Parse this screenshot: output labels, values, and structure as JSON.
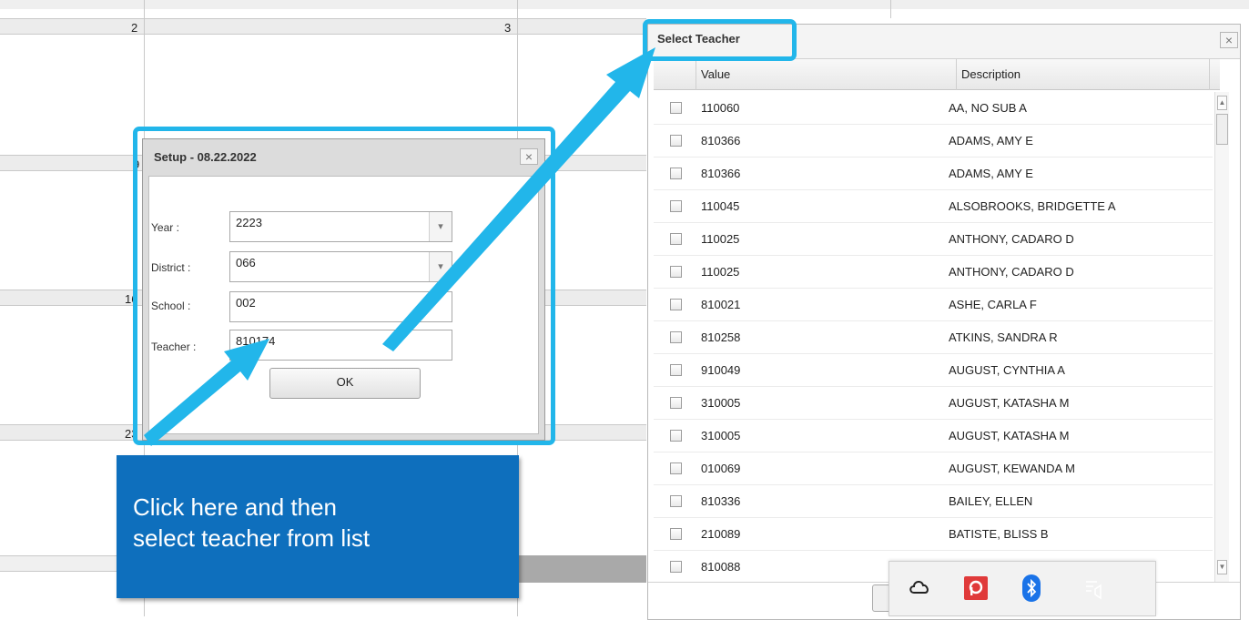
{
  "calendar": {
    "day_numbers": [
      "2",
      "3",
      "9",
      "16",
      "23"
    ]
  },
  "setup_dialog": {
    "title": "Setup - 08.22.2022",
    "close": "×",
    "year_label": "Year :",
    "year_value": "2223",
    "district_label": "District :",
    "district_value": "066",
    "school_label": "School :",
    "school_value": "002",
    "teacher_label": "Teacher :",
    "teacher_value": "810174",
    "ok_label": "OK"
  },
  "teacher_panel": {
    "title": "Select Teacher",
    "close": "×",
    "col_value": "Value",
    "col_description": "Description",
    "rows": [
      {
        "value": "110060",
        "description": "AA, NO SUB A"
      },
      {
        "value": "810366",
        "description": "ADAMS, AMY E"
      },
      {
        "value": "810366",
        "description": "ADAMS, AMY E"
      },
      {
        "value": "110045",
        "description": "ALSOBROOKS, BRIDGETTE A"
      },
      {
        "value": "110025",
        "description": "ANTHONY, CADARO D"
      },
      {
        "value": "110025",
        "description": "ANTHONY, CADARO D"
      },
      {
        "value": "810021",
        "description": "ASHE, CARLA F"
      },
      {
        "value": "810258",
        "description": "ATKINS, SANDRA R"
      },
      {
        "value": "910049",
        "description": "AUGUST, CYNTHIA A"
      },
      {
        "value": "310005",
        "description": "AUGUST, KATASHA M"
      },
      {
        "value": "310005",
        "description": "AUGUST, KATASHA M"
      },
      {
        "value": "010069",
        "description": "AUGUST, KEWANDA M"
      },
      {
        "value": "810336",
        "description": "BAILEY, ELLEN"
      },
      {
        "value": "210089",
        "description": "BATISTE, BLISS B"
      },
      {
        "value": "810088",
        "description": ""
      }
    ]
  },
  "callout": {
    "line1": "Click here and then",
    "line2": "select teacher from list"
  },
  "tray": {
    "icons": [
      "cloud-icon",
      "pdf-reader-icon",
      "bluetooth-icon",
      "notification-icon"
    ],
    "accent_red": "#e03a3a",
    "accent_blue": "#1a73e8"
  },
  "colors": {
    "highlight": "#22b6ea",
    "callout": "#0e6fbd"
  }
}
